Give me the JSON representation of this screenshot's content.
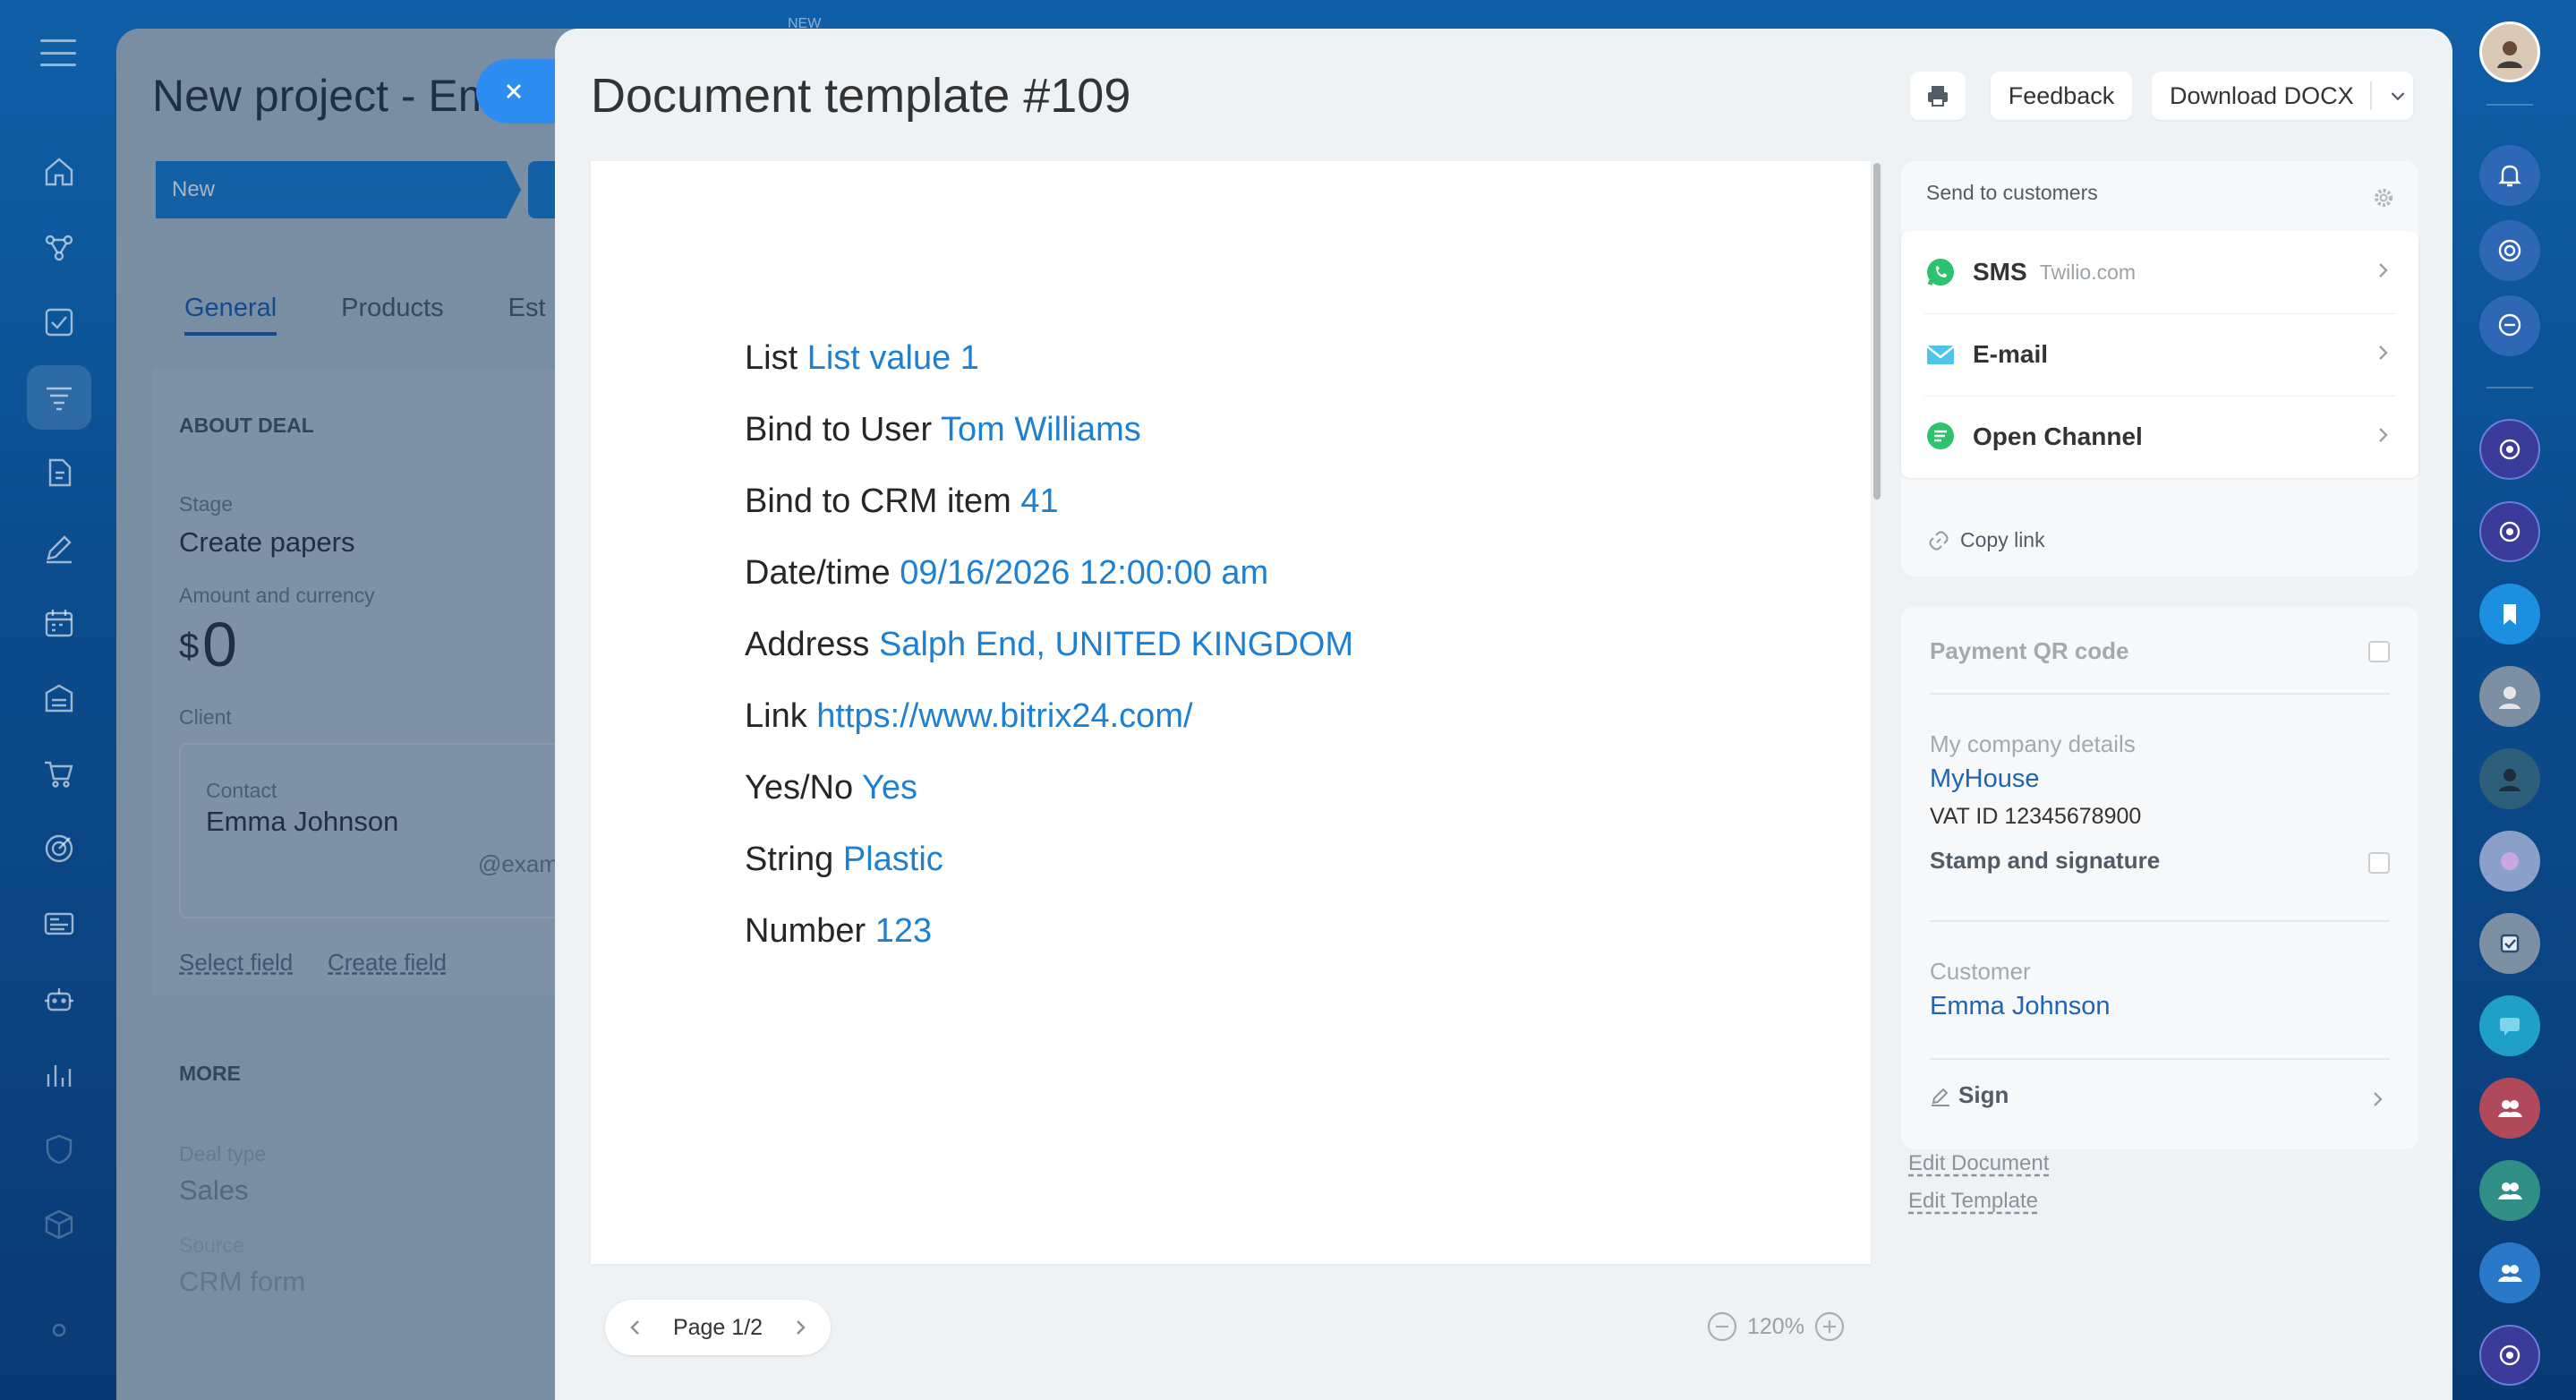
{
  "background": {
    "project_title": "New project - Em",
    "stage_new": "New",
    "tabs": [
      "General",
      "Products",
      "Est"
    ],
    "section_about": "ABOUT DEAL",
    "stage_label": "Stage",
    "stage_value": "Create papers",
    "amount_label": "Amount and currency",
    "amount_currency": "$",
    "amount_value": "0",
    "client_label": "Client",
    "contact_label": "Contact",
    "contact_value": "Emma Johnson",
    "contact_email": "@exam",
    "select_field": "Select field",
    "create_field": "Create field",
    "section_more": "MORE",
    "deal_type_label": "Deal type",
    "deal_type_value": "Sales",
    "source_label": "Source",
    "source_value": "CRM form"
  },
  "top_badge": "NEW",
  "header": {
    "title": "Document template #109",
    "feedback": "Feedback",
    "download": "Download DOCX"
  },
  "document": {
    "lines": [
      {
        "label": "List",
        "value": "List value 1"
      },
      {
        "label": "Bind to User",
        "value": "Tom Williams"
      },
      {
        "label": "Bind to CRM item",
        "value": "41"
      },
      {
        "label": "Date/time",
        "value": "09/16/2026 12:00:00 am"
      },
      {
        "label": "Address",
        "value": "Salph End, UNITED KINGDOM"
      },
      {
        "label": "Link",
        "value": "https://www.bitrix24.com/"
      },
      {
        "label": "Yes/No",
        "value": "Yes"
      },
      {
        "label": "String",
        "value": "Plastic"
      },
      {
        "label": "Number",
        "value": "123"
      }
    ]
  },
  "pager": {
    "label": "Page 1/2"
  },
  "zoom": {
    "level": "120%"
  },
  "send": {
    "heading": "Send to customers",
    "channels": [
      {
        "name": "SMS",
        "sub": "Twilio.com",
        "icon": "whatsapp-icon",
        "color": "#2fc26e"
      },
      {
        "name": "E-mail",
        "sub": "",
        "icon": "mail-icon",
        "color": "#4fc3e8"
      },
      {
        "name": "Open Channel",
        "sub": "",
        "icon": "chat-icon",
        "color": "#2fc26e"
      }
    ],
    "copy_link": "Copy link"
  },
  "details": {
    "payment_qr": "Payment QR code",
    "company_label": "My company details",
    "company_name": "MyHouse",
    "vat": "VAT ID 12345678900",
    "stamp": "Stamp and signature",
    "customer_label": "Customer",
    "customer_name": "Emma Johnson",
    "sign": "Sign"
  },
  "edit_document": "Edit Document",
  "edit_template": "Edit Template",
  "colors": {
    "accent": "#1f7fd1",
    "link": "#1f64b0",
    "close_button": "#2d8cf0"
  }
}
